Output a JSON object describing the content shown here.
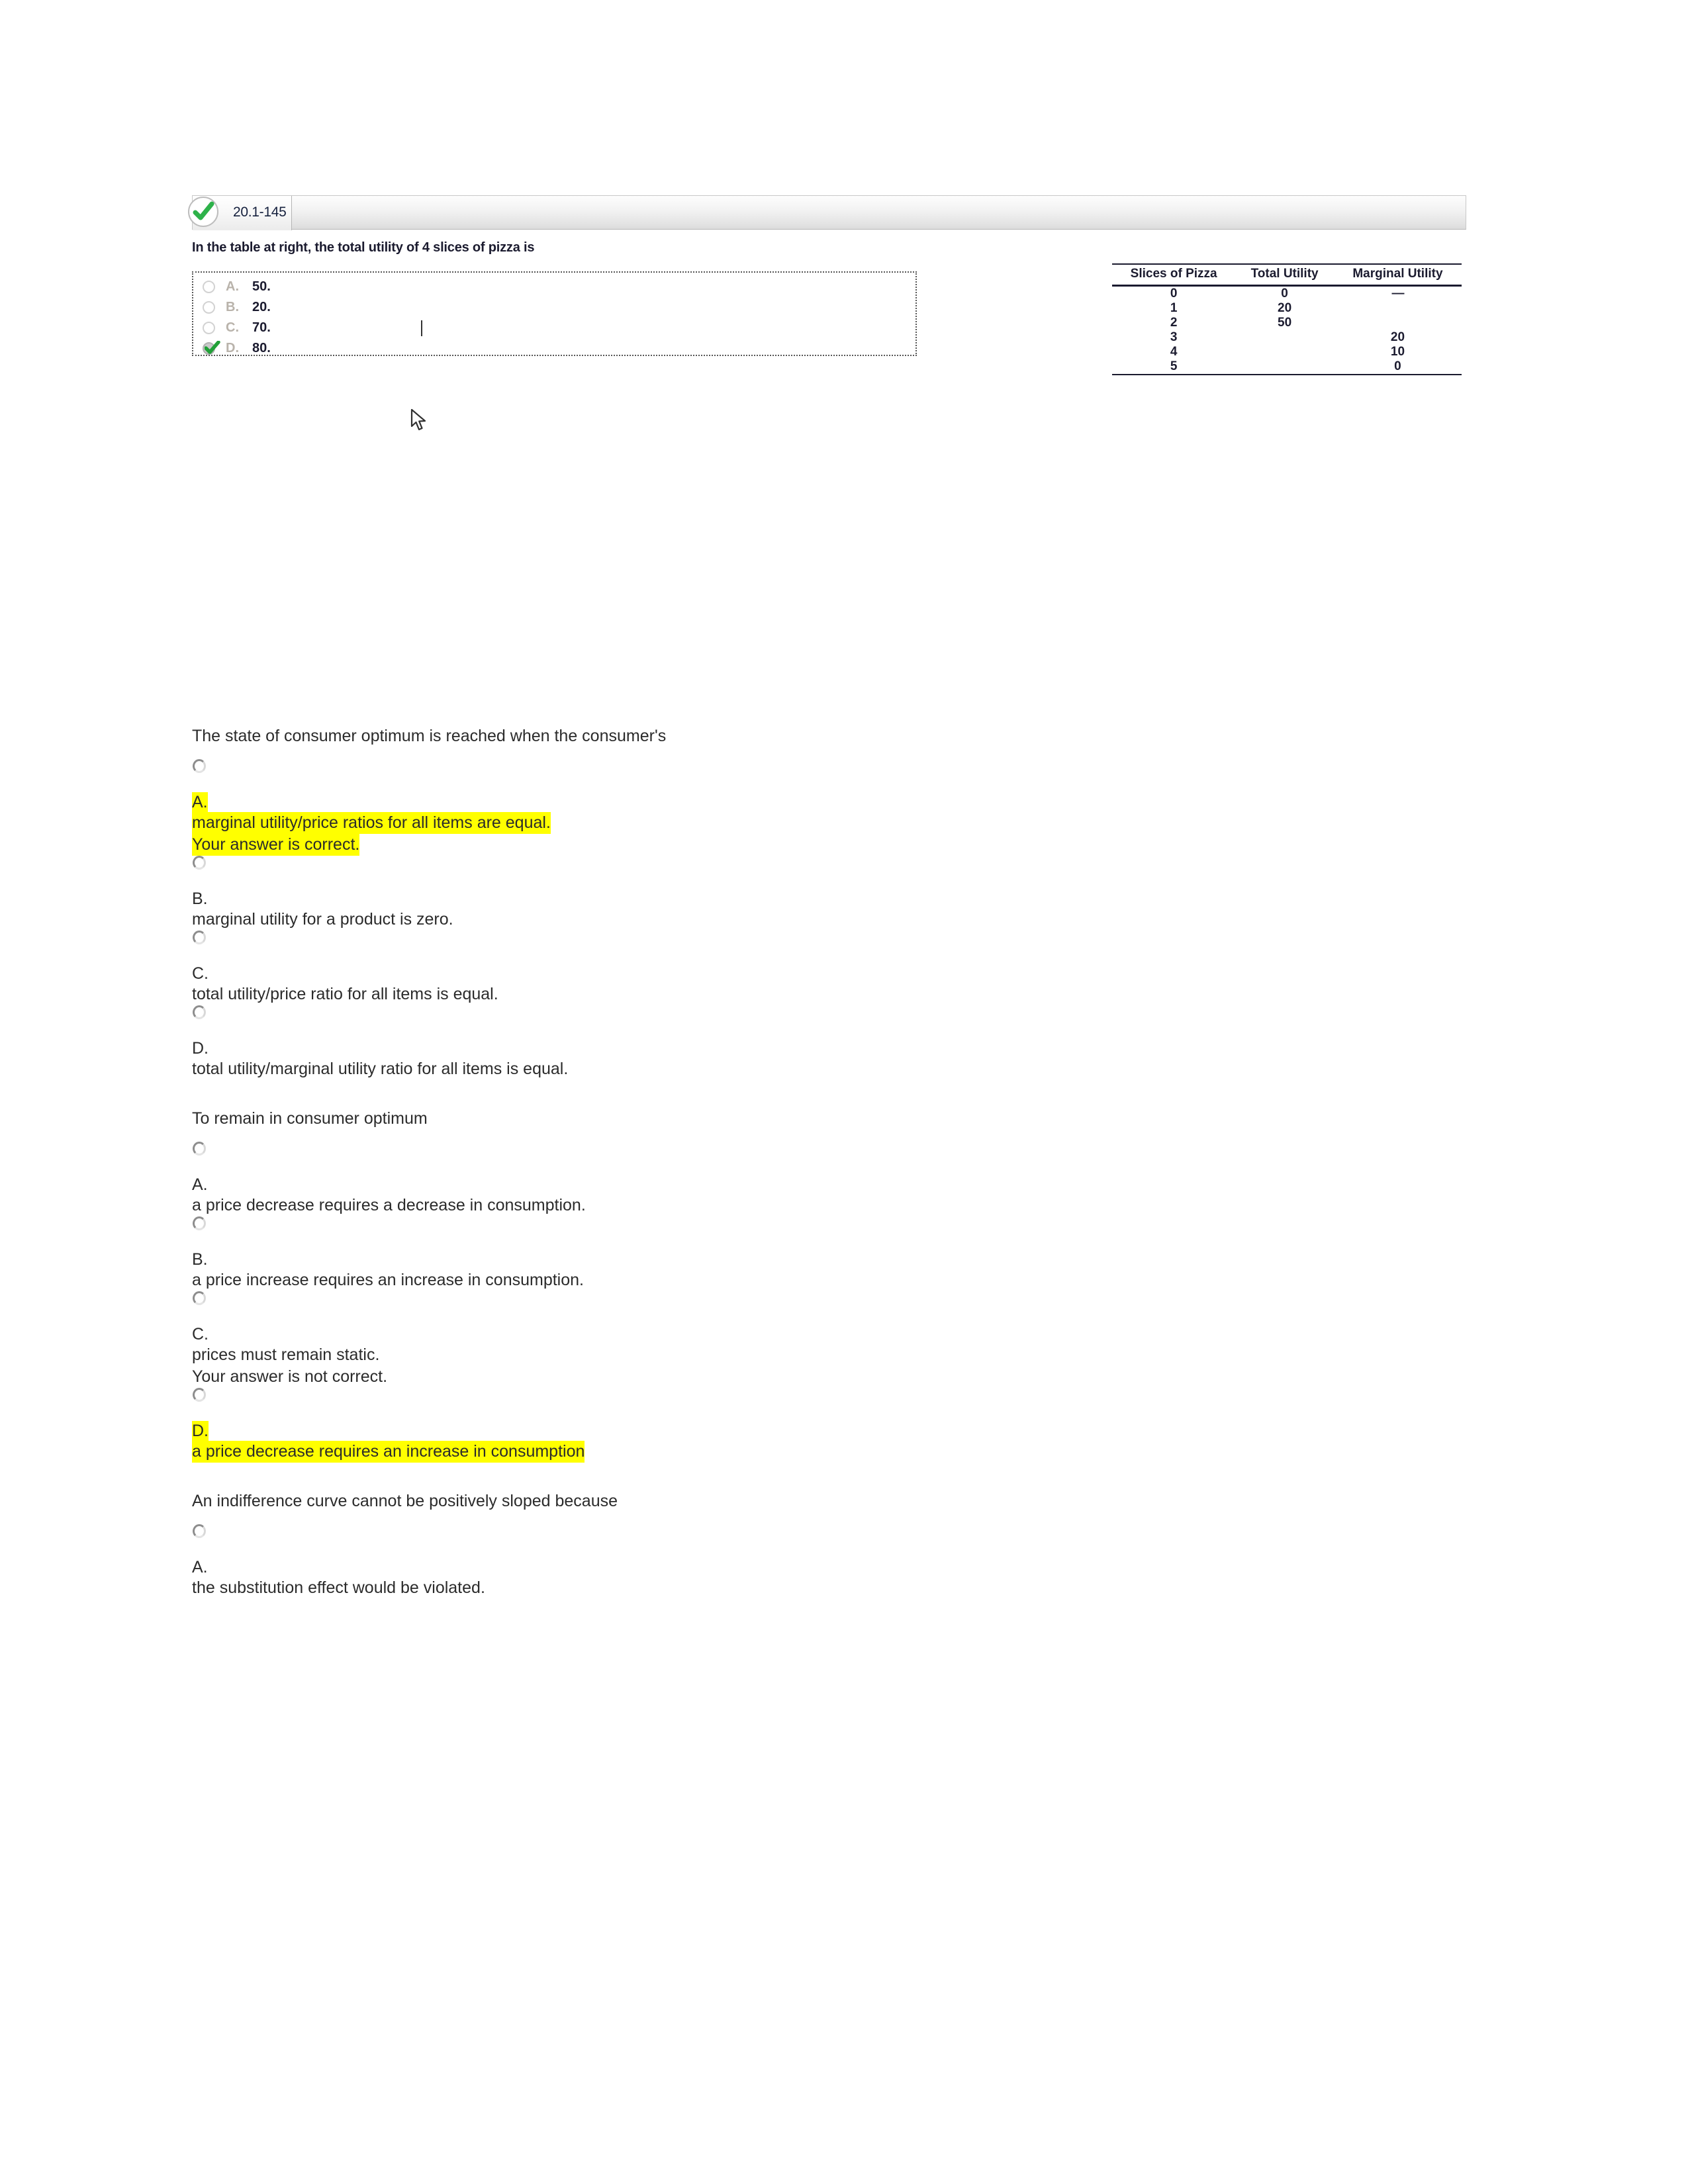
{
  "app": {
    "tab": {
      "label": "20.1-145",
      "status_icon": "check-circle-icon",
      "status": "correct"
    }
  },
  "embedded_question": {
    "stem": "In the table at right, the total utility of 4 slices of pizza is",
    "choices": [
      {
        "letter": "A.",
        "value": "50.",
        "selected": false
      },
      {
        "letter": "B.",
        "value": "20.",
        "selected": false
      },
      {
        "letter": "C.",
        "value": "70.",
        "selected": false
      },
      {
        "letter": "D.",
        "value": "80.",
        "selected": true
      }
    ],
    "table": {
      "headers": [
        "Slices of Pizza",
        "Total Utility",
        "Marginal Utility"
      ],
      "rows": [
        [
          "0",
          "0",
          "—"
        ],
        [
          "1",
          "20",
          ""
        ],
        [
          "2",
          "50",
          ""
        ],
        [
          "3",
          "",
          "20"
        ],
        [
          "4",
          "",
          "10"
        ],
        [
          "5",
          "",
          "0"
        ]
      ]
    }
  },
  "document": {
    "questions": [
      {
        "stem": "The state of consumer optimum is reached when the consumer's",
        "options": [
          {
            "letter": "A.",
            "text": "marginal utility/price ratios for all items are equal.",
            "note": "Your answer is correct.",
            "highlight": true
          },
          {
            "letter": "B.",
            "text": "marginal utility for a product is zero.",
            "note": "",
            "highlight": false
          },
          {
            "letter": "C.",
            "text": "total utility/price ratio for all items is equal.",
            "note": "",
            "highlight": false
          },
          {
            "letter": "D.",
            "text": "total utility/marginal utility ratio for all items is equal.",
            "note": "",
            "highlight": false
          }
        ]
      },
      {
        "stem": "To remain in consumer optimum",
        "options": [
          {
            "letter": "A.",
            "text": "a price decrease requires a decrease in consumption.",
            "note": "",
            "highlight": false
          },
          {
            "letter": "B.",
            "text": "a price increase requires an increase in consumption.",
            "note": "",
            "highlight": false
          },
          {
            "letter": "C.",
            "text": "prices must remain static.",
            "note": "Your answer is not correct.",
            "highlight": false
          },
          {
            "letter": "D.",
            "text": "a price decrease requires an increase in consumption",
            "note": "",
            "highlight": true
          }
        ]
      },
      {
        "stem": "An indifference curve cannot be positively sloped because",
        "options": [
          {
            "letter": "A.",
            "text": "the substitution effect would be violated.",
            "note": "",
            "highlight": false
          }
        ]
      }
    ]
  },
  "colors": {
    "highlight": "#ffff00",
    "check_green": "#2eb24a",
    "text": "#2b2b2b"
  }
}
